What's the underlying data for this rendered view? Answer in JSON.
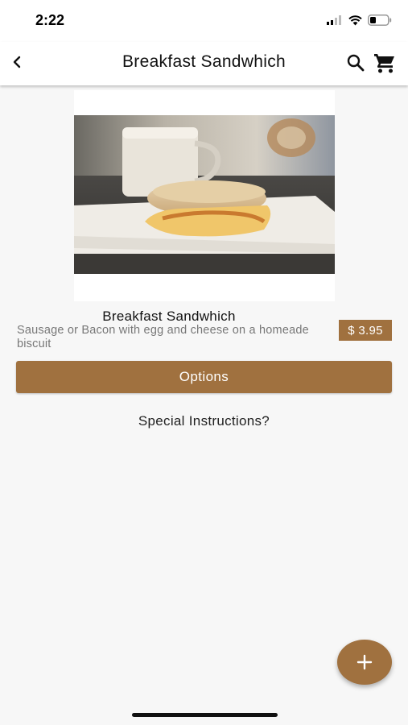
{
  "status_bar": {
    "time": "2:22"
  },
  "app_bar": {
    "title": "Breakfast Sandwhich"
  },
  "item": {
    "name": "Breakfast Sandwhich",
    "description": "Sausage or Bacon with egg and cheese on a homeade biscuit",
    "price": "$ 3.95"
  },
  "actions": {
    "options_label": "Options",
    "special_instructions_label": "Special Instructions?",
    "fab_label": "+"
  },
  "colors": {
    "accent": "#a0713f",
    "background": "#f7f7f7",
    "app_bar": "#ffffff"
  },
  "icons": [
    "back-chevron-icon",
    "search-icon",
    "cart-icon",
    "plus-icon",
    "signal-icon",
    "wifi-icon",
    "battery-icon"
  ]
}
